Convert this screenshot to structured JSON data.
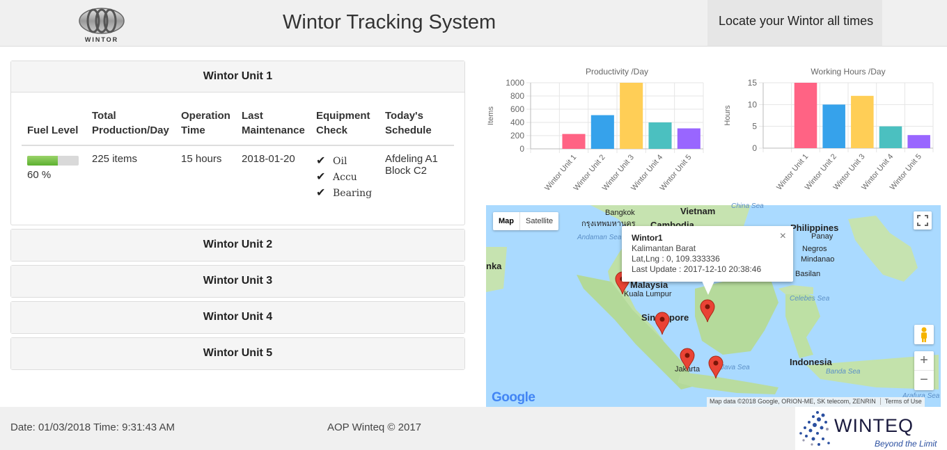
{
  "header": {
    "logo_text": "WINTOR",
    "title": "Wintor Tracking System",
    "tagline": "Locate your Wintor all times"
  },
  "units": [
    {
      "name": "Wintor Unit 1",
      "expanded": true,
      "table": {
        "headers": [
          "Fuel Level",
          "Total Production/Day",
          "Operation Time",
          "Last Maintenance",
          "Equipment Check",
          "Today's Schedule"
        ],
        "fuel_percent": 60,
        "fuel_label": "60 %",
        "production": "225 items",
        "operation_time": "15 hours",
        "last_maintenance": "2018-01-20",
        "equipment_check": [
          "Oil",
          "Accu",
          "Bearing"
        ],
        "schedule": [
          "Afdeling A1",
          "Block C2"
        ]
      }
    },
    {
      "name": "Wintor Unit 2",
      "expanded": false
    },
    {
      "name": "Wintor Unit 3",
      "expanded": false
    },
    {
      "name": "Wintor Unit 4",
      "expanded": false
    },
    {
      "name": "Wintor Unit 5",
      "expanded": false
    }
  ],
  "chart_data": [
    {
      "type": "bar",
      "title": "Productivity /Day",
      "xlabel": "",
      "ylabel": "Items",
      "categories": [
        "Wintor Unit 1",
        "Wintor Unit 2",
        "Wintor Unit 3",
        "Wintor Unit 4",
        "Wintor Unit 5"
      ],
      "values": [
        225,
        510,
        1000,
        400,
        310
      ],
      "yticks": [
        0,
        200,
        400,
        600,
        800,
        1000
      ],
      "ylim": [
        0,
        1000
      ],
      "colors": [
        "#ff6384",
        "#36a2eb",
        "#ffce56",
        "#4bc0c0",
        "#9966ff"
      ],
      "grid": true
    },
    {
      "type": "bar",
      "title": "Working Hours /Day",
      "xlabel": "",
      "ylabel": "Hours",
      "categories": [
        "Wintor Unit 1",
        "Wintor Unit 2",
        "Wintor Unit 3",
        "Wintor Unit 4",
        "Wintor Unit 5"
      ],
      "values": [
        15,
        10,
        12,
        5,
        3
      ],
      "yticks": [
        0,
        5,
        10,
        15
      ],
      "ylim": [
        0,
        15
      ],
      "colors": [
        "#ff6384",
        "#36a2eb",
        "#ffce56",
        "#4bc0c0",
        "#9966ff"
      ],
      "grid": true
    }
  ],
  "map": {
    "type_map": "Map",
    "type_satellite": "Satellite",
    "places": {
      "vietnam": "Vietnam",
      "bangkok": "Bangkok",
      "bangkok_thai": "กรุงเทพมหานคร",
      "cambodia": "Cambodia",
      "philippines": "Philippines",
      "panay": "Panay",
      "negros": "Negros",
      "mindanao": "Mindanao",
      "basilan": "Basilan",
      "nka": "nka",
      "malaysia": "Malaysia",
      "kuala_lumpur": "Kuala Lumpur",
      "singapore_a": "Sin",
      "singapore_b": "pore",
      "jakarta": "Jakarta",
      "indonesia": "Indonesia"
    },
    "seas": {
      "china_sea": "China Sea",
      "andaman_sea": "Andaman Sea",
      "celebes_sea": "Celebes Sea",
      "java_sea": "Java Sea",
      "banda_sea": "Banda Sea",
      "arafura_sea": "Arafura Sea"
    },
    "infowindow": {
      "title": "Wintor1",
      "region": "Kalimantan Barat",
      "latlng": "Lat,Lng : 0, 109.333336",
      "last_update": "Last Update : 2017-12-10 20:38:46",
      "close": "×"
    },
    "google": "Google",
    "attribution": "Map data ©2018 Google, ORION-ME, SK telecom, ZENRIN",
    "terms": "Terms of Use",
    "zoom_in": "+",
    "zoom_out": "−"
  },
  "footer": {
    "datetime": "Date: 01/03/2018 Time: 9:31:43 AM",
    "copyright": "AOP Winteq © 2017",
    "brand": "WINTEQ",
    "slogan": "Beyond the Limit"
  }
}
